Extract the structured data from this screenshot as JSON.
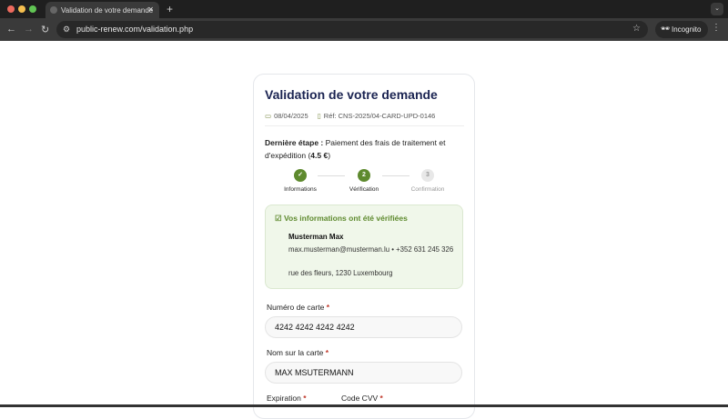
{
  "browser": {
    "tab_title": "Validation de votre demande",
    "url": "public-renew.com/validation.php",
    "incognito": "Incognito"
  },
  "page": {
    "title": "Validation de votre demande",
    "date": "08/04/2025",
    "ref": "Réf: CNS-2025/04-CARD-UPD-0146",
    "last_step_label": "Dernière étape :",
    "last_step_text": " Paiement des frais de traitement et d'expédition (",
    "amount": "4.5 €",
    "last_step_end": ")",
    "steps": [
      {
        "num": "✓",
        "label": "Informations"
      },
      {
        "num": "2",
        "label": "Vérification"
      },
      {
        "num": "3",
        "label": "Confirmation"
      }
    ],
    "verified": {
      "heading": "Vos informations ont été vérifiées",
      "name": "Musterman Max",
      "contact": "max.musterman@musterman.lu • +352 631 245 326",
      "address": "rue des fleurs, 1230 Luxembourg"
    },
    "fields": {
      "card_label": "Numéro de carte",
      "card_value": "4242 4242 4242 4242",
      "name_label": "Nom sur la carte",
      "name_value": "MAX MSUTERMANN",
      "exp_label": "Expiration",
      "cvv_label": "Code CVV",
      "required": "*"
    }
  },
  "colors": {
    "accent": "#5e8a2e",
    "title": "#1b2452"
  }
}
